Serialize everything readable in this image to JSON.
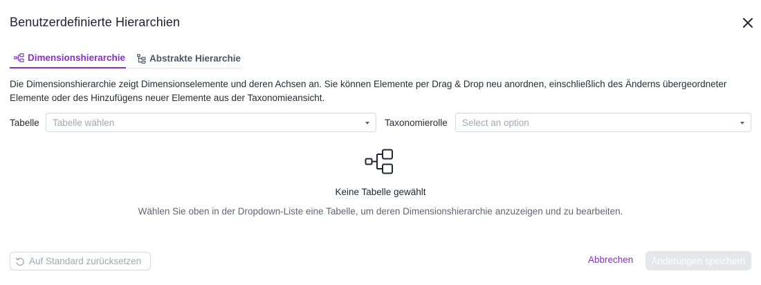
{
  "dialog": {
    "title": "Benutzerdefinierte Hierarchien",
    "close_icon": "close-icon"
  },
  "tabs": [
    {
      "label": "Dimensionshierarchie",
      "icon": "hierarchy-icon",
      "active": true
    },
    {
      "label": "Abstrakte Hierarchie",
      "icon": "tree-icon",
      "active": false
    }
  ],
  "description": "Die Dimensionshierarchie zeigt Dimensionselemente und deren Achsen an. Sie können Elemente per Drag & Drop neu anordnen, einschließlich des Änderns übergeordneter Elemente oder des Hinzufügens neuer Elemente aus der Taxonomieansicht.",
  "filters": {
    "table_label": "Tabelle",
    "table_placeholder": "Tabelle wählen",
    "role_label": "Taxonomierolle",
    "role_placeholder": "Select an option"
  },
  "empty_state": {
    "icon": "hierarchy-icon",
    "title": "Keine Tabelle gewählt",
    "subtitle": "Wählen Sie oben in der Dropdown-Liste eine Tabelle, um deren Dimensionshierarchie anzuzeigen und zu bearbeiten."
  },
  "footer": {
    "reset_label": "Auf Standard zurücksetzen",
    "reset_icon": "reset-icon",
    "cancel_label": "Abbrechen",
    "save_label": "Änderungen speichern"
  },
  "colors": {
    "accent": "#8a2ec9",
    "disabled_bg": "#e5e7ea",
    "border": "#d6d9de"
  }
}
